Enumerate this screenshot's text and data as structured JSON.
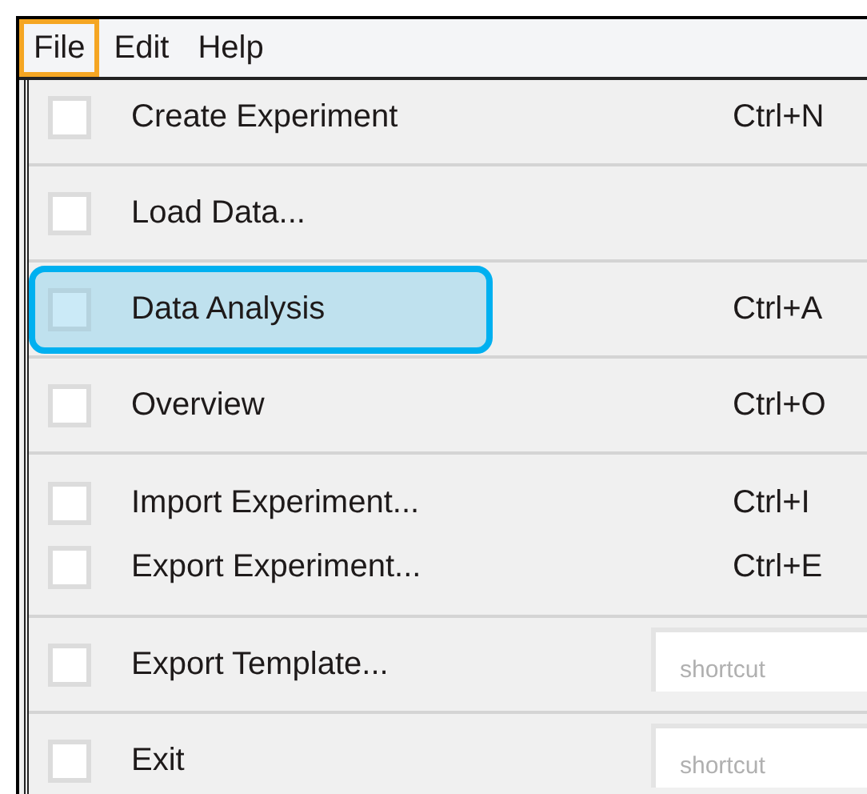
{
  "menubar": [
    {
      "label": "File",
      "selected": true
    },
    {
      "label": "Edit",
      "selected": false
    },
    {
      "label": "Help",
      "selected": false
    }
  ],
  "menu_groups": [
    [
      {
        "kind": "item",
        "label": "Create Experiment",
        "shortcut": "Ctrl+N",
        "checked": false,
        "selected": false
      }
    ],
    [
      {
        "kind": "item",
        "label": "Load Data...",
        "checked": false,
        "selected": false
      }
    ],
    [
      {
        "kind": "item",
        "label": "Data Analysis",
        "shortcut": "Ctrl+A",
        "checked": false,
        "selected": true
      }
    ],
    [
      {
        "kind": "item",
        "label": "Overview",
        "shortcut": "Ctrl+O",
        "checked": false,
        "selected": false
      }
    ],
    [
      {
        "kind": "item",
        "label": "Import Experiment...",
        "shortcut": "Ctrl+I",
        "checked": false,
        "selected": false
      },
      {
        "kind": "item",
        "label": "Export Experiment...",
        "shortcut": "Ctrl+E",
        "checked": false,
        "selected": false
      }
    ],
    [
      {
        "kind": "field",
        "label": "Export Template...",
        "placeholder": "shortcut",
        "checked": false,
        "selected": false
      }
    ],
    [
      {
        "kind": "field",
        "label": "Exit",
        "placeholder": "shortcut",
        "checked": false,
        "selected": false
      }
    ]
  ]
}
